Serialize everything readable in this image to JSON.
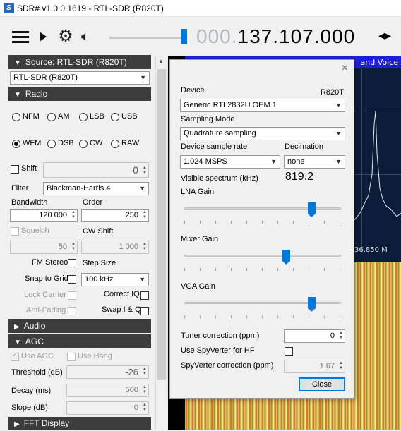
{
  "window": {
    "title": "SDR# v1.0.0.1619 - RTL-SDR (R820T)",
    "logo_text": "S"
  },
  "toolbar": {
    "frequency_dim": "000.",
    "frequency_main": "137.107.000",
    "arrows": "◂▸"
  },
  "left": {
    "source_header": "Source: RTL-SDR (R820T)",
    "source_value": "RTL-SDR (R820T)",
    "radio_header": "Radio",
    "modes": [
      "NFM",
      "AM",
      "LSB",
      "USB",
      "WFM",
      "DSB",
      "CW",
      "RAW"
    ],
    "selected_mode": "WFM",
    "shift_label": "Shift",
    "shift_value": "0",
    "filter_label": "Filter",
    "filter_value": "Blackman-Harris 4",
    "bandwidth_label": "Bandwidth",
    "bandwidth_value": "120 000",
    "order_label": "Order",
    "order_value": "250",
    "squelch_label": "Squelch",
    "squelch_value": "50",
    "cwshift_label": "CW Shift",
    "cwshift_value": "1 000",
    "fmstereo_label": "FM Stereo",
    "stepsize_label": "Step Size",
    "snap_label": "Snap to Grid",
    "step_value": "100 kHz",
    "lockcarrier_label": "Lock Carrier",
    "correctiq_label": "Correct IQ",
    "antifading_label": "Anti-Fading",
    "swapiq_label": "Swap I & Q",
    "audio_header": "Audio",
    "agc_header": "AGC",
    "useagc_label": "Use AGC",
    "usehang_label": "Use Hang",
    "threshold_label": "Threshold (dB)",
    "threshold_value": "-26",
    "decay_label": "Decay (ms)",
    "decay_value": "500",
    "slope_label": "Slope (dB)",
    "slope_value": "0",
    "fft_header": "FFT Display"
  },
  "spectrum": {
    "band_label": "and Voice",
    "freq_tick": "36.850 M"
  },
  "dialog": {
    "device_label": "Device",
    "device_tuner": "R820T",
    "device_value": "Generic RTL2832U OEM 1",
    "sampling_mode_label": "Sampling Mode",
    "sampling_mode_value": "Quadrature sampling",
    "sample_rate_label": "Device sample rate",
    "sample_rate_value": "1.024 MSPS",
    "decimation_label": "Decimation",
    "decimation_value": "none",
    "visible_label": "Visible spectrum (kHz)",
    "visible_value": "819.2",
    "lna_label": "LNA Gain",
    "lna_level": 0.83,
    "mixer_label": "Mixer Gain",
    "mixer_level": 0.66,
    "vga_label": "VGA Gain",
    "vga_level": 0.83,
    "tuner_corr_label": "Tuner correction (ppm)",
    "tuner_corr_value": "0",
    "spyverter_label": "Use SpyVerter for HF",
    "spyverter_corr_label": "SpyVerter correction (ppm)",
    "spyverter_corr_value": "1.67",
    "close_label": "Close",
    "close_icon": "×"
  }
}
